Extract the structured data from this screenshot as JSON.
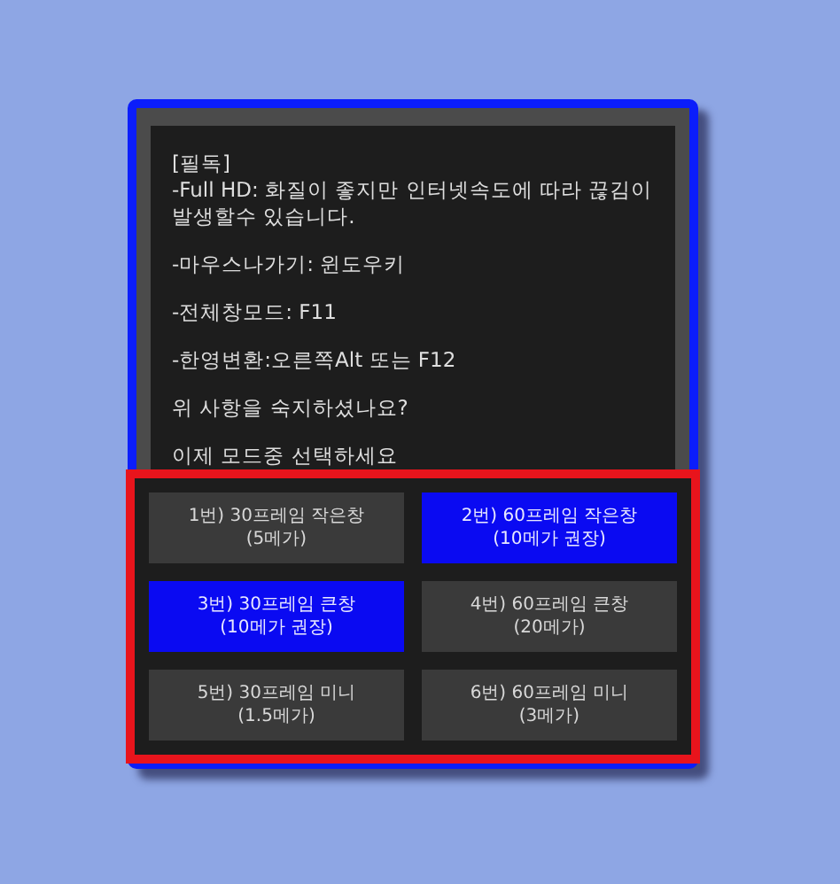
{
  "notice": {
    "heading": "[필독]",
    "lines": [
      "-Full HD: 화질이 좋지만 인터넷속도에 따라 끊김이 발생할수 있습니다.",
      "-마우스나가기: 윈도우키",
      "-전체창모드: F11",
      "-한영변환:오른쪽Alt 또는 F12",
      "위 사항을 숙지하셨나요?",
      "이제 모드중 선택하세요"
    ]
  },
  "mode_buttons": [
    {
      "label": "1번) 30프레임 작은창",
      "note": "(5메가)",
      "selected": false
    },
    {
      "label": "2번) 60프레임 작은창",
      "note": "(10메가 권장)",
      "selected": true
    },
    {
      "label": "3번) 30프레임 큰창",
      "note": "(10메가 권장)",
      "selected": true
    },
    {
      "label": "4번) 60프레임 큰창",
      "note": "(20메가)",
      "selected": false
    },
    {
      "label": "5번) 30프레임 미니",
      "note": "(1.5메가)",
      "selected": false
    },
    {
      "label": "6번) 60프레임 미니",
      "note": "(3메가)",
      "selected": false
    }
  ]
}
